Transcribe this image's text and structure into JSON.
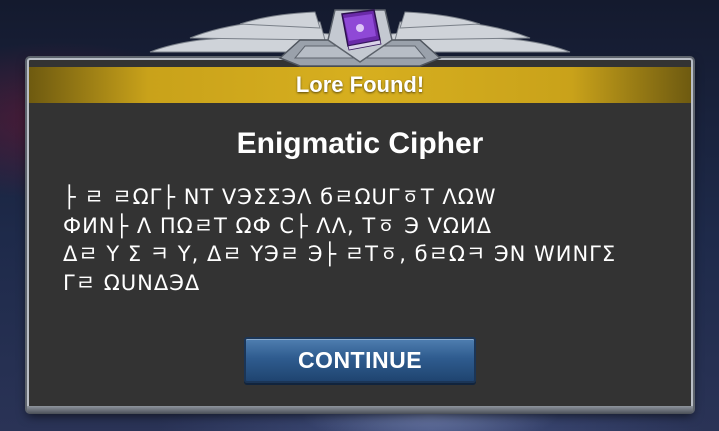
{
  "dialog": {
    "header_title": "Lore Found!",
    "lore_title": "Enigmatic Cipher",
    "lore_lines": [
      "├ ㄹ ㄹΩΓ├ NT VЭΣΣЭΛ бㄹΩUΓㆆT ΛΩW",
      "ФИN├ Λ ΠΩㄹT ΩФ C├ ΛΛ, Tㆆ Э VΩИΔ",
      "Δㄹ Y Σ ㅋ Y, Δㄹ YЭㄹ Э├ ㄹTㆆ, бㄹΩㅋ ЭN WИNΓΣ",
      "Γㄹ ΩUNΔЭΔ"
    ],
    "continue_label": "CONTINUE"
  },
  "icons": {
    "ornament": "winged-crest-icon",
    "book": "purple-book-icon"
  },
  "colors": {
    "panel": "#333333",
    "header_gold": "#d7af1f",
    "button_blue": "#2f5c8f",
    "text": "#ffffff"
  }
}
